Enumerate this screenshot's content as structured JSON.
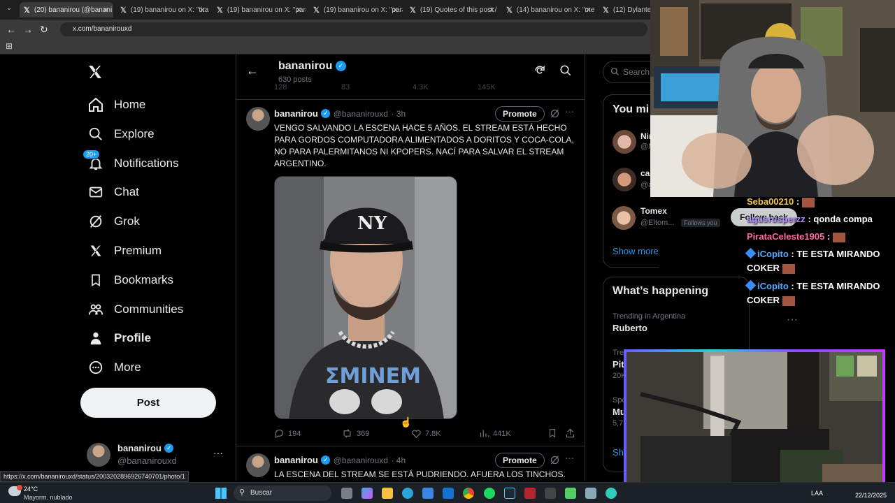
{
  "browser": {
    "tabs": [
      {
        "title": "(20) bananirou (@banani"
      },
      {
        "title": "(19) bananirou on X: \"tira"
      },
      {
        "title": "(19) bananirou on X: \"para"
      },
      {
        "title": "(19) bananirou on X: \"para"
      },
      {
        "title": "(19) Quotes of this post /"
      },
      {
        "title": "(14) bananirou on X: \"me"
      },
      {
        "title": "(12) Dylantero"
      }
    ],
    "url": "x.com/bananirouxd",
    "status_url": "https://x.com/bananirouxd/status/2003202896926740701/photo/1"
  },
  "nav": {
    "items": [
      {
        "label": "Home",
        "icon": "home-icon"
      },
      {
        "label": "Explore",
        "icon": "search-icon"
      },
      {
        "label": "Notifications",
        "icon": "bell-icon",
        "badge": "20+"
      },
      {
        "label": "Chat",
        "icon": "mail-icon"
      },
      {
        "label": "Grok",
        "icon": "grok-icon"
      },
      {
        "label": "Premium",
        "icon": "x-logo-icon"
      },
      {
        "label": "Bookmarks",
        "icon": "bookmark-icon"
      },
      {
        "label": "Communities",
        "icon": "people-icon"
      },
      {
        "label": "Profile",
        "icon": "person-icon"
      },
      {
        "label": "More",
        "icon": "more-circle-icon"
      }
    ],
    "post_label": "Post",
    "account": {
      "name": "bananirou",
      "handle": "@bananirouxd"
    }
  },
  "profile_header": {
    "name": "bananirou",
    "posts_count": "630 posts"
  },
  "prev_post_stats": {
    "replies": "128",
    "reposts": "83",
    "likes": "4.3K",
    "views": "145K"
  },
  "posts": [
    {
      "name": "bananirou",
      "handle": "@bananirouxd",
      "time": "· 3h",
      "promote_label": "Promote",
      "text": "VENGO SALVANDO LA ESCENA HACE 5 AÑOS. EL STREAM ESTÁ HECHO PARA GORDOS COMPUTADORA ALIMENTADOS A DORITOS Y COCA-COLA, NO PARA PALERMITANOS NI KPOPERS. NACÍ PARA SALVAR EL STREAM ARGENTINO.",
      "stats": {
        "replies": "194",
        "reposts": "369",
        "likes": "7.8K",
        "views": "441K"
      }
    },
    {
      "name": "bananirou",
      "handle": "@bananirouxd",
      "time": "· 4h",
      "promote_label": "Promote",
      "text": "LA ESCENA DEL STREAM SE ESTÁ PUDRIENDO. AFUERA LOS TINCHOS."
    }
  ],
  "right": {
    "search_placeholder": "Search",
    "who_to_follow_title": "You mi",
    "follow": [
      {
        "name": "Nir",
        "handle": "@N"
      },
      {
        "name": "ca",
        "handle": "@a"
      },
      {
        "name": "Tomex",
        "handle": "@Eltom...",
        "follows_you": "Follows you",
        "button": "Follow back"
      }
    ],
    "show_more": "Show more",
    "happening_title": "What’s happening",
    "trends": [
      {
        "context": "Trending in Argentina",
        "name": "Ruberto"
      },
      {
        "context": "Tre",
        "name": "Pit",
        "count": "20K"
      },
      {
        "context": "Spo",
        "name": "Mu",
        "count": "5,7"
      }
    ],
    "show_more_2": "Sho"
  },
  "chat": [
    {
      "user": "Seba00210",
      "msg": ":",
      "color": "#f2c94c"
    },
    {
      "user": "agusrusperzz",
      "msg": ": qonda compa",
      "color": "#b68cff"
    },
    {
      "user": "PirataCeleste1905",
      "msg": ":",
      "color": "#ff6b9a"
    },
    {
      "user": "iCopito",
      "msg": ": TE ESTA MIRANDO COKER",
      "color": "#5aa8ff"
    },
    {
      "user": "iCopito",
      "msg": ": TE ESTA MIRANDO COKER",
      "color": "#5aa8ff"
    }
  ],
  "taskbar": {
    "weather_temp": "24°C",
    "weather_desc": "Mayorm. nublado",
    "search_label": "Buscar",
    "lang": "LAA",
    "date": "22/12/2025"
  }
}
